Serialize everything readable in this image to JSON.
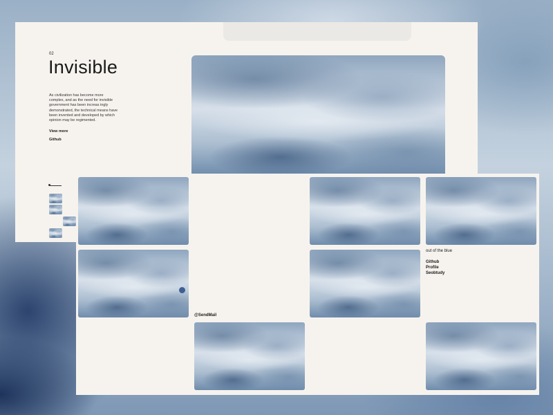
{
  "project": {
    "number": "02",
    "title": "Invisible",
    "description": "As civilization has become more complex, and as the need for invisible government has been increas ingly demonstrated, the technical means have been invented and developed by which opinion may be regimented.",
    "view_more": "View more",
    "github": "Github"
  },
  "gallery": {
    "caption": "out of the blue",
    "links": [
      "Github",
      "Profile",
      "Seobtudy"
    ],
    "contact": "@SendMail"
  },
  "colors": {
    "paper": "#f6f3ee",
    "accent_dot": "#3d5f92"
  }
}
